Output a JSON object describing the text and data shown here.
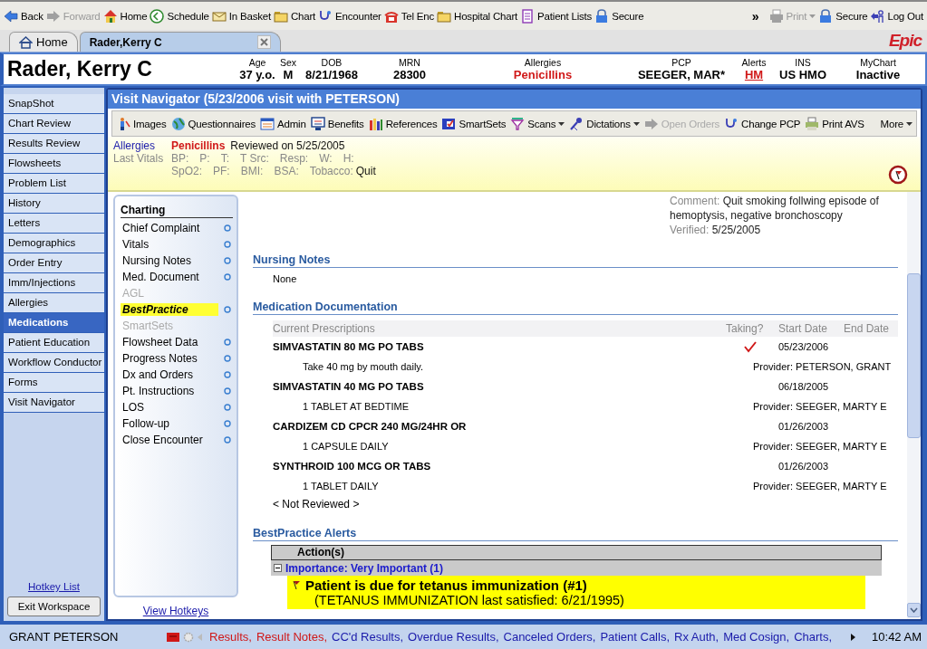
{
  "toolbar": {
    "items": [
      {
        "label": "Back",
        "disabled": false
      },
      {
        "label": "Forward",
        "disabled": true
      },
      {
        "label": "Home",
        "disabled": false
      },
      {
        "label": "Schedule",
        "disabled": false
      },
      {
        "label": "In Basket",
        "disabled": false
      },
      {
        "label": "Chart",
        "disabled": false
      },
      {
        "label": "Encounter",
        "disabled": false
      },
      {
        "label": "Tel Enc",
        "disabled": false
      },
      {
        "label": "Hospital Chart",
        "disabled": false
      },
      {
        "label": "Patient Lists",
        "disabled": false
      },
      {
        "label": "Secure",
        "disabled": false
      }
    ],
    "overflow": "»",
    "right_items": [
      {
        "label": "Print",
        "disabled": true,
        "dropdown": true
      },
      {
        "label": "Secure",
        "disabled": false,
        "dropdown": false
      },
      {
        "label": "Log Out",
        "disabled": false,
        "dropdown": false
      }
    ]
  },
  "tabs": [
    {
      "label": "Home",
      "selected": false,
      "closable": false
    },
    {
      "label": "Rader,Kerry C",
      "selected": true,
      "closable": true
    }
  ],
  "logo": "Epic",
  "patient": {
    "name": "Rader, Kerry C",
    "fields": [
      {
        "label": "Age",
        "value": "37 y.o.",
        "kind": "plain"
      },
      {
        "label": "Sex",
        "value": "M",
        "kind": "plain"
      },
      {
        "label": "DOB",
        "value": "8/21/1968",
        "kind": "plain"
      },
      {
        "label": "MRN",
        "value": "28300",
        "kind": "plain"
      },
      {
        "label": "Allergies",
        "value": "Penicillins",
        "kind": "alert"
      },
      {
        "label": "PCP",
        "value": "SEEGER, MAR*",
        "kind": "plain"
      },
      {
        "label": "Alerts",
        "value": "HM",
        "kind": "link"
      },
      {
        "label": "INS",
        "value": "US HMO",
        "kind": "plain"
      },
      {
        "label": "MyChart",
        "value": "Inactive",
        "kind": "plain"
      }
    ]
  },
  "sidebar": {
    "items": [
      {
        "label": "SnapShot",
        "selected": false
      },
      {
        "label": "Chart Review",
        "selected": false
      },
      {
        "label": "Results Review",
        "selected": false
      },
      {
        "label": "Flowsheets",
        "selected": false
      },
      {
        "label": "Problem List",
        "selected": false
      },
      {
        "label": "History",
        "selected": false
      },
      {
        "label": "Letters",
        "selected": false
      },
      {
        "label": "Demographics",
        "selected": false
      },
      {
        "label": "Order Entry",
        "selected": false
      },
      {
        "label": "Imm/Injections",
        "selected": false
      },
      {
        "label": "Allergies",
        "selected": false
      },
      {
        "label": "Medications",
        "selected": true
      },
      {
        "label": "Patient Education",
        "selected": false
      },
      {
        "label": "Workflow Conductor",
        "selected": false
      },
      {
        "label": "Forms",
        "selected": false
      },
      {
        "label": "Visit Navigator",
        "selected": false
      }
    ],
    "hotkey_link": "Hotkey List",
    "exit_button": "Exit Workspace"
  },
  "navigator": {
    "title": "Visit Navigator (5/23/2006 visit with PETERSON)",
    "toolbar": [
      {
        "label": "Images",
        "disabled": false,
        "dropdown": false
      },
      {
        "label": "Questionnaires",
        "disabled": false,
        "dropdown": false
      },
      {
        "label": "Admin",
        "disabled": false,
        "dropdown": false
      },
      {
        "label": "Benefits",
        "disabled": false,
        "dropdown": false
      },
      {
        "label": "References",
        "disabled": false,
        "dropdown": false
      },
      {
        "label": "SmartSets",
        "disabled": false,
        "dropdown": false
      },
      {
        "label": "Scans",
        "disabled": false,
        "dropdown": true
      },
      {
        "label": "Dictations",
        "disabled": false,
        "dropdown": true
      },
      {
        "label": "Open Orders",
        "disabled": true,
        "dropdown": false
      },
      {
        "label": "Change PCP",
        "disabled": false,
        "dropdown": false
      },
      {
        "label": "Print AVS",
        "disabled": false,
        "dropdown": false
      }
    ],
    "more": "More",
    "allergies_label": "Allergies",
    "allergies_value": "Penicillins",
    "allergies_reviewed": "Reviewed on 5/25/2005",
    "vitals_label": "Last Vitals",
    "vitals": [
      [
        {
          "label": "BP:"
        },
        {
          "label": "P:"
        },
        {
          "label": "T:"
        },
        {
          "label": "T Src:"
        },
        {
          "label": "Resp:"
        },
        {
          "label": "W:"
        },
        {
          "label": "H:"
        }
      ],
      [
        {
          "label": "SpO2:"
        },
        {
          "label": "PF:"
        },
        {
          "label": "BMI:"
        },
        {
          "label": "BSA:"
        },
        {
          "label": "Tobacco:",
          "value": "Quit"
        }
      ]
    ]
  },
  "charting": {
    "heading": "Charting",
    "items": [
      {
        "label": "Chief Complaint",
        "selected": false,
        "disabled": false
      },
      {
        "label": "Vitals",
        "selected": false,
        "disabled": false
      },
      {
        "label": "Nursing Notes",
        "selected": false,
        "disabled": false
      },
      {
        "label": "Med. Document",
        "selected": false,
        "disabled": false
      },
      {
        "label": "AGL",
        "selected": false,
        "disabled": true
      },
      {
        "label": "BestPractice",
        "selected": true,
        "disabled": false
      },
      {
        "label": "SmartSets",
        "selected": false,
        "disabled": true
      },
      {
        "label": "Flowsheet Data",
        "selected": false,
        "disabled": false
      },
      {
        "label": "Progress Notes",
        "selected": false,
        "disabled": false
      },
      {
        "label": "Dx and Orders",
        "selected": false,
        "disabled": false
      },
      {
        "label": "Pt. Instructions",
        "selected": false,
        "disabled": false
      },
      {
        "label": "LOS",
        "selected": false,
        "disabled": false
      },
      {
        "label": "Follow-up",
        "selected": false,
        "disabled": false
      },
      {
        "label": "Close Encounter",
        "selected": false,
        "disabled": false
      }
    ],
    "hotkeys_link": "View Hotkeys"
  },
  "content": {
    "comment_label": "Comment:",
    "comment": "Quit smoking follwing episode of hemoptysis, negative bronchoscopy",
    "verified_label": "Verified:",
    "verified": "5/25/2005",
    "nursing": {
      "heading": "Nursing Notes",
      "text": "None"
    },
    "medications": {
      "heading": "Medication Documentation",
      "columns": [
        "Current Prescriptions",
        "Taking?",
        "Start Date",
        "End Date"
      ],
      "rows": [
        {
          "name": "SIMVASTATIN 80 MG PO TABS",
          "taking": true,
          "start": "05/23/2006",
          "sig": "Take 40 mg by mouth daily.",
          "provider": "Provider: PETERSON, GRANT"
        },
        {
          "name": "SIMVASTATIN 40 MG PO TABS",
          "taking": false,
          "start": "06/18/2005",
          "sig": "1 TABLET AT BEDTIME",
          "provider": "Provider: SEEGER, MARTY E"
        },
        {
          "name": "CARDIZEM CD CPCR 240 MG/24HR OR",
          "taking": false,
          "start": "01/26/2003",
          "sig": "1 CAPSULE DAILY",
          "provider": "Provider: SEEGER, MARTY E"
        },
        {
          "name": "SYNTHROID 100 MCG OR TABS",
          "taking": false,
          "start": "01/26/2003",
          "sig": "1 TABLET DAILY",
          "provider": "Provider: SEEGER, MARTY E"
        }
      ],
      "not_reviewed": "< Not Reviewed >"
    },
    "bpa": {
      "heading": "BestPractice Alerts",
      "column": "Action(s)",
      "group": "Importance: Very Important (1)",
      "expanded": true,
      "alert": "Patient is due for tetanus immunization (#1)",
      "detail": "(TETANUS IMMUNIZATION last satisfied: 6/21/1995)"
    }
  },
  "status_bar": {
    "user": "GRANT PETERSON",
    "links": [
      {
        "label": "Results,",
        "new": true
      },
      {
        "label": "Result Notes,",
        "new": true
      },
      {
        "label": "CC'd Results,",
        "new": false
      },
      {
        "label": "Overdue Results,",
        "new": false
      },
      {
        "label": "Canceled Orders,",
        "new": false
      },
      {
        "label": "Patient Calls,",
        "new": false
      },
      {
        "label": "Rx Auth,",
        "new": false
      },
      {
        "label": "Med Cosign,",
        "new": false
      },
      {
        "label": "Charts,",
        "new": false
      }
    ],
    "time": "10:42 AM"
  }
}
